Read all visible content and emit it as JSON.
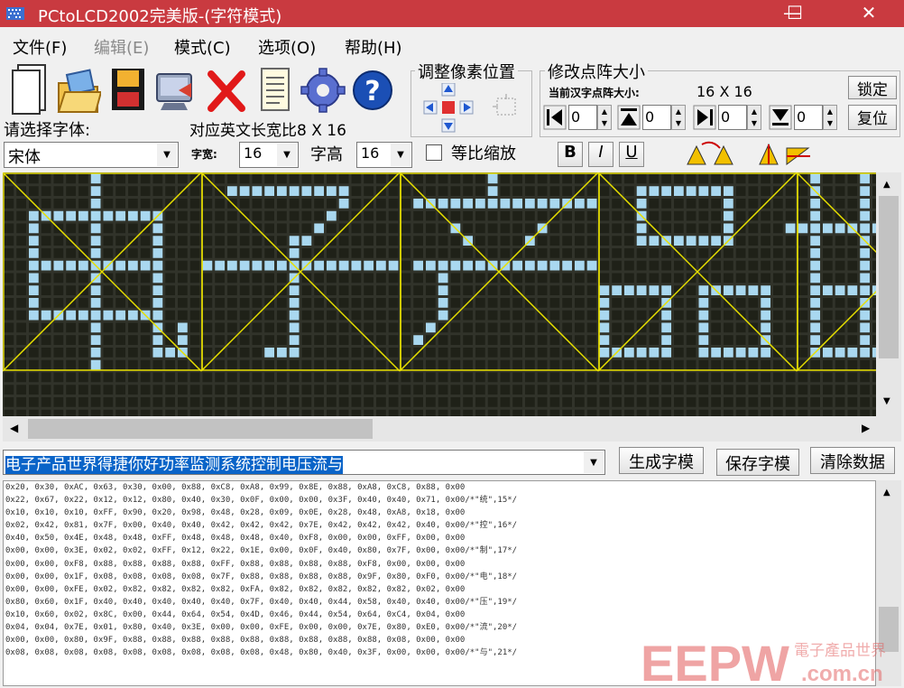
{
  "window": {
    "title": "PCtoLCD2002完美版-(字符模式)",
    "minimize": "—",
    "maximize": "☐",
    "close": "✕"
  },
  "menu": [
    "文件(F)",
    "编辑(E)",
    "模式(C)",
    "选项(O)",
    "帮助(H)"
  ],
  "adjust_group": {
    "title": "调整像素位置"
  },
  "matrix_group": {
    "title": "修改点阵大小",
    "current_label": "当前汉字点阵大小:",
    "current_value": "16  X  16",
    "lock_button": "锁定",
    "reset_button": "复位",
    "spinners": [
      "0",
      "0",
      "0",
      "0"
    ]
  },
  "font_panel": {
    "choose_font_label": "请选择字体:",
    "ratio_label": "对应英文长宽比8 X 16",
    "font_value": "宋体",
    "width_label": "字宽:",
    "width_value": "16",
    "height_label": "字高",
    "height_value": "16",
    "proportional_label": "等比缩放",
    "proportional_checked": false
  },
  "style_buttons": [
    "B",
    "I",
    "U"
  ],
  "colors": {
    "canvas_bg": "#31332a",
    "pixel_off": "#1f2118",
    "pixel_on": "#a9d8f0",
    "guide": "#e8e000",
    "titlebar": "#c93a40",
    "selection": "#0a64c8"
  },
  "icons": [
    "new-file-icon",
    "open-folder-icon",
    "save-disk-icon",
    "network-icon",
    "delete-icon",
    "notepad-icon",
    "gear-icon",
    "help-icon"
  ],
  "input_text": "电子产品世界得捷你好功率监测系统控制电压流与",
  "actions": {
    "generate": "生成字模",
    "save": "保存字模",
    "clear": "清除数据"
  },
  "output_lines": [
    "0x20, 0x30, 0xAC, 0x63, 0x30, 0x00, 0x88, 0xC8, 0xA8, 0x99, 0x8E, 0x88, 0xA8, 0xC8, 0x88, 0x00",
    "0x22, 0x67, 0x22, 0x12, 0x12, 0x80, 0x40, 0x30, 0x0F, 0x00, 0x00, 0x3F, 0x40, 0x40, 0x71, 0x00/*\"统\",15*/",
    "0x10, 0x10, 0x10, 0xFF, 0x90, 0x20, 0x98, 0x48, 0x28, 0x09, 0x0E, 0x28, 0x48, 0xA8, 0x18, 0x00",
    "0x02, 0x42, 0x81, 0x7F, 0x00, 0x40, 0x40, 0x42, 0x42, 0x42, 0x7E, 0x42, 0x42, 0x42, 0x40, 0x00/*\"控\",16*/",
    "0x40, 0x50, 0x4E, 0x48, 0x48, 0xFF, 0x48, 0x48, 0x48, 0x40, 0xF8, 0x00, 0x00, 0xFF, 0x00, 0x00",
    "0x00, 0x00, 0x3E, 0x02, 0x02, 0xFF, 0x12, 0x22, 0x1E, 0x00, 0x0F, 0x40, 0x80, 0x7F, 0x00, 0x00/*\"制\",17*/",
    "0x00, 0x00, 0xF8, 0x88, 0x88, 0x88, 0x88, 0xFF, 0x88, 0x88, 0x88, 0x88, 0xF8, 0x00, 0x00, 0x00",
    "0x00, 0x00, 0x1F, 0x08, 0x08, 0x08, 0x08, 0x7F, 0x88, 0x88, 0x88, 0x88, 0x9F, 0x80, 0xF0, 0x00/*\"电\",18*/",
    "0x00, 0x00, 0xFE, 0x02, 0x82, 0x82, 0x82, 0x82, 0xFA, 0x82, 0x82, 0x82, 0x82, 0x82, 0x02, 0x00",
    "0x80, 0x60, 0x1F, 0x40, 0x40, 0x40, 0x40, 0x40, 0x7F, 0x40, 0x40, 0x44, 0x58, 0x40, 0x40, 0x00/*\"压\",19*/",
    "0x10, 0x60, 0x02, 0x8C, 0x00, 0x44, 0x64, 0x54, 0x4D, 0x46, 0x44, 0x54, 0x64, 0xC4, 0x04, 0x00",
    "0x04, 0x04, 0x7E, 0x01, 0x80, 0x40, 0x3E, 0x00, 0x00, 0xFE, 0x00, 0x00, 0x7E, 0x80, 0xE0, 0x00/*\"流\",20*/",
    "0x00, 0x00, 0x80, 0x9F, 0x88, 0x88, 0x88, 0x88, 0x88, 0x88, 0x88, 0x88, 0x88, 0x08, 0x00, 0x00",
    "0x08, 0x08, 0x08, 0x08, 0x08, 0x08, 0x08, 0x08, 0x08, 0x48, 0x80, 0x40, 0x3F, 0x00, 0x00, 0x00/*\"与\",21*/"
  ],
  "watermark": {
    "logo": "EEPW",
    "chinese": "電子產品世界",
    "domain": ".com.cn"
  }
}
